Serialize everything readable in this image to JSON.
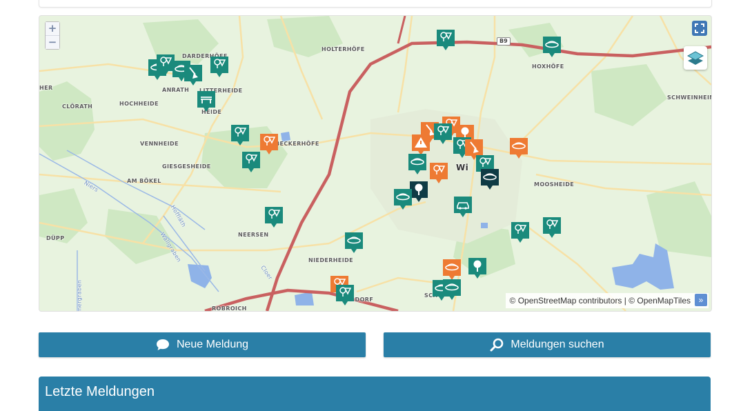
{
  "map": {
    "zoom_in": "+",
    "zoom_out": "−",
    "attribution": "© OpenStreetMap contributors | © OpenMapTiles",
    "attribution_more": "»",
    "road_shield": "B9",
    "places": [
      {
        "key": "darderhofe",
        "label": "DARDERHÖFE"
      },
      {
        "key": "holterhofe",
        "label": "HOLTERHÖFE"
      },
      {
        "key": "hoxhofe",
        "label": "HOXHÖFE"
      },
      {
        "key": "anrath",
        "label": "ANRATH"
      },
      {
        "key": "litterheide",
        "label": "LITTERHEIDE"
      },
      {
        "key": "clorath",
        "label": "CLÖRATH"
      },
      {
        "key": "hochheide",
        "label": "HOCHHEIDE"
      },
      {
        "key": "heide",
        "label": "HEIDE"
      },
      {
        "key": "schweinheim",
        "label": "SCHWEINHEIM"
      },
      {
        "key": "vennheide",
        "label": "VENNHEIDE"
      },
      {
        "key": "beckerhofe",
        "label": "BECKERHÖFE"
      },
      {
        "key": "giesgesheide",
        "label": "GIESGESHEIDE"
      },
      {
        "key": "ambokel",
        "label": "AM BÖKEL"
      },
      {
        "key": "mooshéide",
        "label": "MOOSHEIDE"
      },
      {
        "key": "neersen",
        "label": "NEERSEN"
      },
      {
        "key": "dupp",
        "label": "DÜPP"
      },
      {
        "key": "niederheide",
        "label": "NIEDERHEIDE"
      },
      {
        "key": "elsdorf",
        "label": "ELSDORF"
      },
      {
        "key": "sch",
        "label": "SCH"
      },
      {
        "key": "wi",
        "label": "Wi"
      },
      {
        "key": "her",
        "label": "HER"
      },
      {
        "key": "niers",
        "label": "Niers"
      },
      {
        "key": "hofflith",
        "label": "Hoffläth"
      },
      {
        "key": "wallgraben",
        "label": "Wallgraben"
      },
      {
        "key": "merggraben",
        "label": "mergraben"
      },
      {
        "key": "cloer",
        "label": "Cloer"
      },
      {
        "key": "broich",
        "label": "ROBROICH"
      }
    ]
  },
  "buttons": {
    "new_report": "Neue Meldung",
    "search_reports": "Meldungen suchen"
  },
  "latest_reports": {
    "title": "Letzte Meldungen"
  },
  "colors": {
    "primary": "#2a7fa7",
    "marker_teal": "#1a8a7c",
    "marker_orange": "#ee7a33",
    "marker_dark": "#0f3b45"
  }
}
